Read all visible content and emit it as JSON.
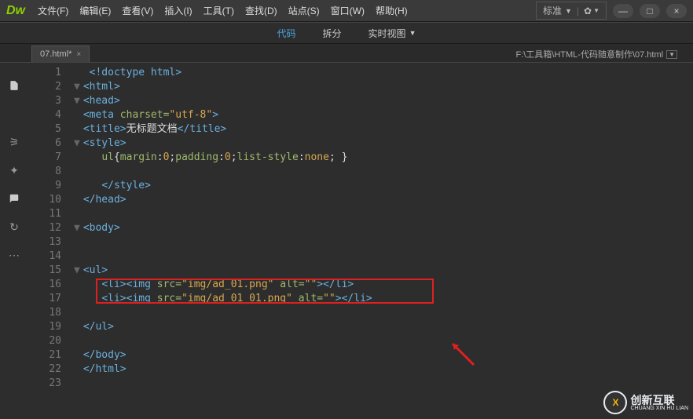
{
  "app": {
    "logo": "Dw"
  },
  "menu": {
    "file": "文件(F)",
    "edit": "编辑(E)",
    "view": "查看(V)",
    "insert": "插入(I)",
    "tools": "工具(T)",
    "find": "查找(D)",
    "site": "站点(S)",
    "window": "窗口(W)",
    "help": "帮助(H)"
  },
  "layout": {
    "label": "标准"
  },
  "win": {
    "min": "—",
    "max": "□",
    "close": "×"
  },
  "toolbar": {
    "code": "代码",
    "split": "拆分",
    "live": "实时视图"
  },
  "tab": {
    "name": "07.html*"
  },
  "path": {
    "text": "F:\\工具箱\\HTML-代码随意制作\\07.html"
  },
  "code": {
    "l1": {
      "a": "<!doctype html>"
    },
    "l2": {
      "a": "<html>"
    },
    "l3": {
      "a": "<head>"
    },
    "l4": {
      "a": "<meta",
      "b": " charset=",
      "c": "\"utf-8\"",
      "d": ">"
    },
    "l5": {
      "a": "<title>",
      "b": "无标题文档",
      "c": "</title>"
    },
    "l6": {
      "a": "<style>"
    },
    "l7": {
      "a": "ul",
      "b": "{",
      "c": "margin",
      "d": ":",
      "e": "0",
      "f": ";",
      "g": "padding",
      "h": ":",
      "i": "0",
      "j": ";",
      "k": "list-style",
      "l": ":",
      "m": "none",
      "n": "; }"
    },
    "l9": {
      "a": "</style>"
    },
    "l10": {
      "a": "</head>"
    },
    "l12": {
      "a": "<body>"
    },
    "l15": {
      "a": "<ul>"
    },
    "l16": {
      "a": "<li><img",
      "b": " src=",
      "c": "\"img/ad_01.png\"",
      "d": " alt=",
      "e": "\"\"",
      "f": "></li>"
    },
    "l17": {
      "a": "<li><img",
      "b": " src=",
      "c": "\"img/ad_01_01.png\"",
      "d": " alt=",
      "e": "\"\"",
      "f": "></li>"
    },
    "l19": {
      "a": "</ul>"
    },
    "l21": {
      "a": "</body>"
    },
    "l22": {
      "a": "</html>"
    }
  },
  "watermark": {
    "icon": "X",
    "l1": "创新互联",
    "l2": "CHUANG XIN HU LIAN"
  }
}
